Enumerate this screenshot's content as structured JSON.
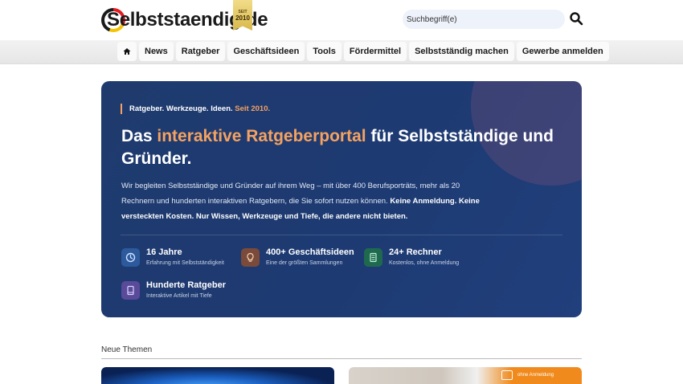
{
  "header": {
    "logo_text": "Selbststaendig.de",
    "badge_top": "SEIT",
    "badge_year": "2010",
    "search_placeholder": "Suchbegriff(e)"
  },
  "nav": {
    "home_icon": "home-icon",
    "items": [
      "News",
      "Ratgeber",
      "Geschäftsideen",
      "Tools",
      "Fördermittel",
      "Selbstständig machen",
      "Gewerbe anmelden"
    ]
  },
  "hero": {
    "kicker_main": "Ratgeber. Werkzeuge. Ideen.",
    "kicker_accent": "Seit 2010.",
    "title_pre": "Das ",
    "title_accent": "interaktive Ratgeberportal",
    "title_post": " für Selbstständige und Gründer.",
    "desc_plain": "Wir begleiten Selbstständige und Gründer auf ihrem Weg – mit über 400 Berufsporträts, mehr als 20 Rechnern und hunderten interaktiven Ratgebern, die Sie sofort nutzen können. ",
    "desc_bold": "Keine Anmeldung. Keine versteckten Kosten. Nur Wissen, Werkzeuge und Tiefe, die andere nicht bieten.",
    "stats": [
      {
        "title": "16 Jahre",
        "sub": "Erfahrung mit Selbstständigkeit",
        "icon": "clock-icon",
        "color": "#2c5a9c"
      },
      {
        "title": "400+ Geschäftsideen",
        "sub": "Eine der größten Sammlungen",
        "icon": "lightbulb-icon",
        "color": "#7a4a3a"
      },
      {
        "title": "24+ Rechner",
        "sub": "Kostenlos, ohne Anmeldung",
        "icon": "calculator-icon",
        "color": "#1f6a4f"
      },
      {
        "title": "Hunderte Ratgeber",
        "sub": "Interaktive Artikel mit Tiefe",
        "icon": "book-icon",
        "color": "#5a4a9a"
      }
    ]
  },
  "section": {
    "title": "Neue Themen",
    "card2_label": "ohne Anmeldung"
  },
  "colors": {
    "accent": "#f4a261",
    "hero_bg": "#1f3b6e"
  }
}
